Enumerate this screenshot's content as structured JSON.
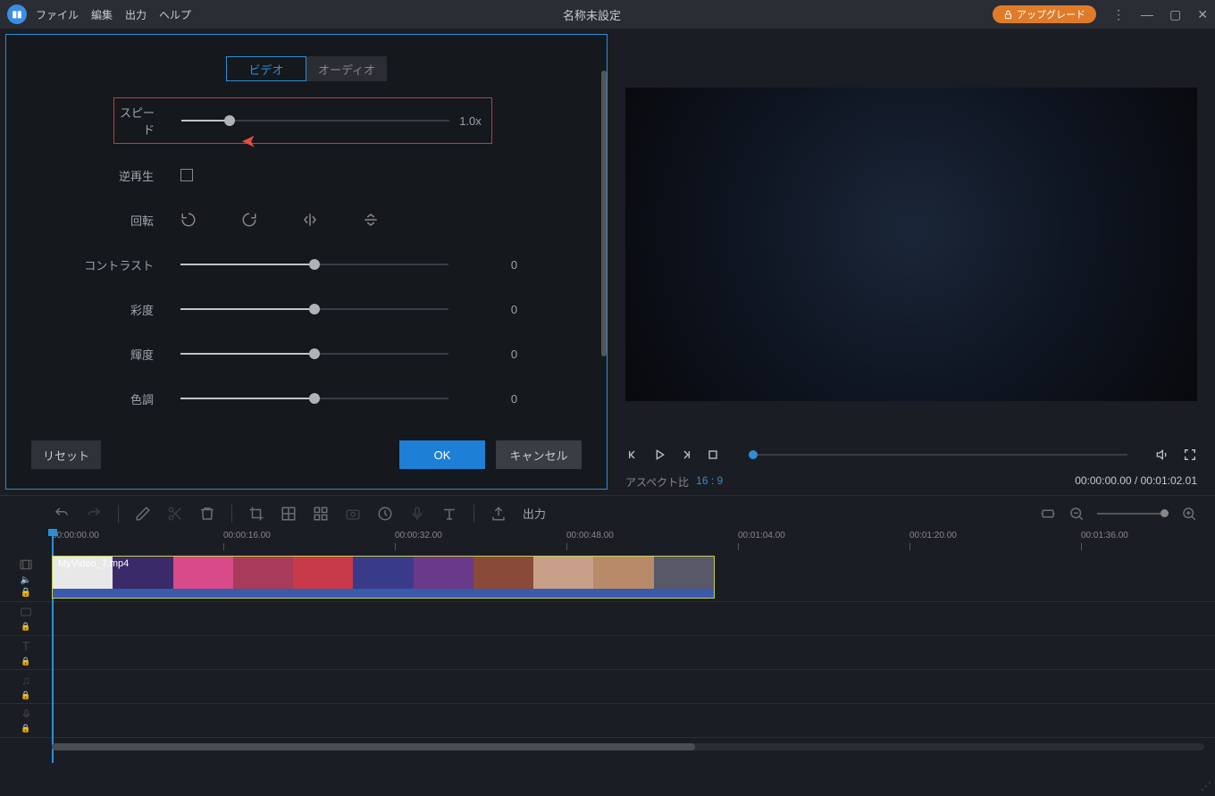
{
  "titlebar": {
    "menu": {
      "file": "ファイル",
      "edit": "編集",
      "output": "出力",
      "help": "ヘルプ"
    },
    "title": "名称未設定",
    "upgrade": "アップグレード"
  },
  "panel": {
    "tabs": {
      "video": "ビデオ",
      "audio": "オーディオ"
    },
    "controls": {
      "speed": {
        "label": "スピード",
        "value": "1.0x",
        "pct": 18
      },
      "reverse": {
        "label": "逆再生"
      },
      "rotate": {
        "label": "回転"
      },
      "contrast": {
        "label": "コントラスト",
        "value": "0",
        "pct": 50
      },
      "saturation": {
        "label": "彩度",
        "value": "0",
        "pct": 50
      },
      "brightness": {
        "label": "輝度",
        "value": "0",
        "pct": 50
      },
      "hue": {
        "label": "色調",
        "value": "0",
        "pct": 50
      }
    },
    "buttons": {
      "reset": "リセット",
      "ok": "OK",
      "cancel": "キャンセル"
    }
  },
  "preview": {
    "aspect_label": "アスペクト比",
    "aspect_value": "16 : 9",
    "time": "00:00:00.00 / 00:01:02.01"
  },
  "toolbar": {
    "export": "出力"
  },
  "timeline": {
    "ticks": [
      "00:00:00.00",
      "00:00:16.00",
      "00:00:32.00",
      "00:00:48.00",
      "00:01:04.00",
      "00:01:20.00",
      "00:01:36.00"
    ],
    "clip_name": "MyVideo_7.mp4",
    "thumb_colors": [
      "#e8e8e8",
      "#3a2a6a",
      "#d84a8a",
      "#a83a5a",
      "#c83a4a",
      "#3a3a8a",
      "#6a3a8a",
      "#8a4a3a",
      "#c8a08a",
      "#b88a6a",
      "#585868"
    ]
  }
}
